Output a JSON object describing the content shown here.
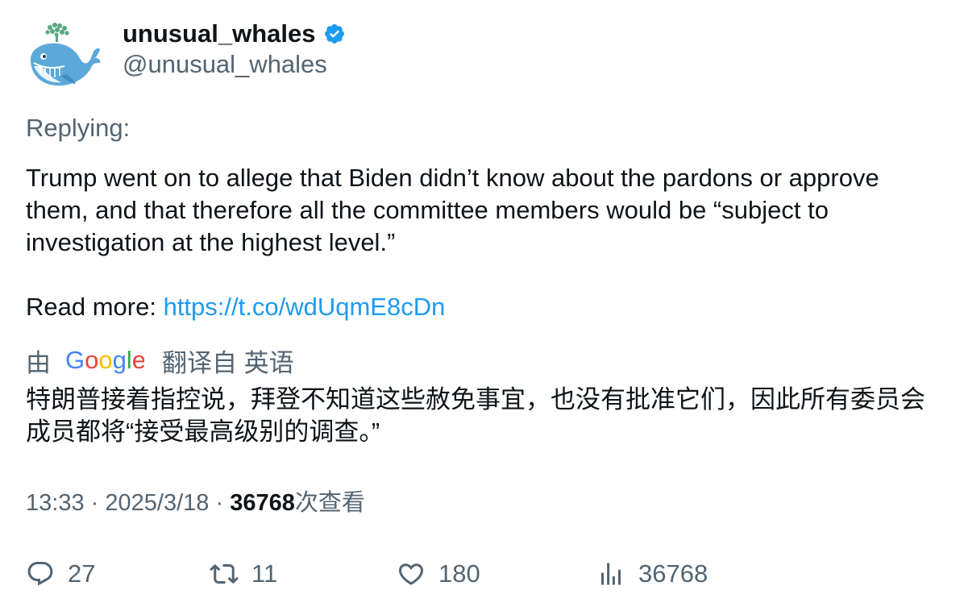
{
  "author": {
    "display_name": "unusual_whales",
    "handle": "@unusual_whales",
    "verified": true
  },
  "replying_label": "Replying:",
  "tweet": {
    "text": "Trump went on to allege that Biden didn’t know about the pardons or approve them, and that therefore all the committee members would be “subject to investigation at the highest level.”",
    "read_more_label": "Read more: ",
    "link": "https://t.co/wdUqmE8cDn"
  },
  "translation": {
    "by_label": "由",
    "provider": "Google",
    "from_label": "翻译自 英语",
    "text": "特朗普接着指控说，拜登不知道这些赦免事宜，也没有批准它们，因此所有委员会成员都将“接受最高级别的调查。”"
  },
  "meta": {
    "time": "13:33",
    "separator": "·",
    "date": "2025/3/18",
    "views_count": "36768",
    "views_label": "次查看"
  },
  "actions": {
    "reply_count": "27",
    "retweet_count": "11",
    "like_count": "180",
    "views_count": "36768"
  },
  "colors": {
    "text_primary": "#0f1419",
    "text_secondary": "#536471",
    "link": "#1d9bf0",
    "verified": "#1d9bf0"
  },
  "icons": {
    "avatar": "whale-logo",
    "verified": "verified-badge-icon",
    "reply": "reply-icon",
    "retweet": "retweet-icon",
    "like": "heart-icon",
    "views": "bar-chart-icon"
  }
}
